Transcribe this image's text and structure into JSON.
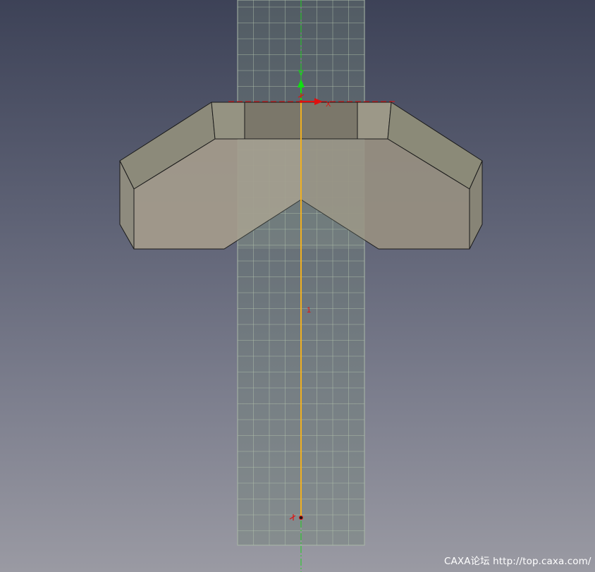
{
  "viewport": {
    "background_top": "#3d4257",
    "background_bottom": "#9a9aa3"
  },
  "triad": {
    "x_axis_label": "X",
    "x_axis_color": "#e01010",
    "y_axis_color": "#10e010"
  },
  "sketch": {
    "dimension_label": "1",
    "line_color": "#f0b020",
    "centerline_color": "#20d020",
    "grid_color": "#b8c8b0"
  },
  "solid": {
    "face_color": "#9a9383",
    "edge_color": "#1a1a1a"
  },
  "watermark": {
    "text": "CAXA论坛 http://top.caxa.com/"
  }
}
